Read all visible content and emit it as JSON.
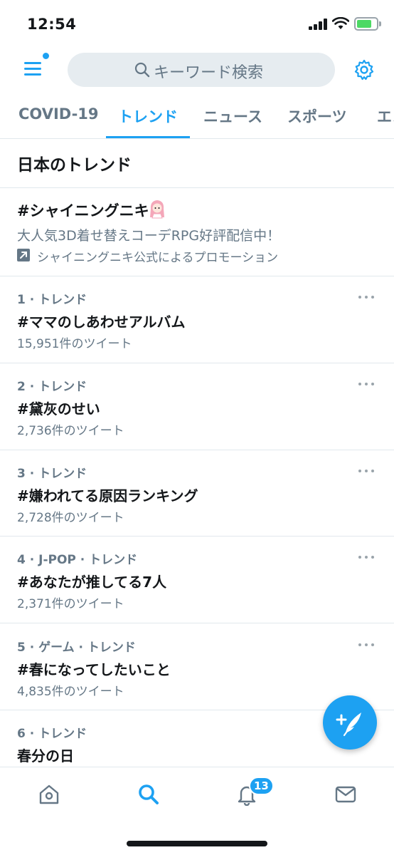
{
  "status_bar": {
    "time": "12:54"
  },
  "header": {
    "search_placeholder": "キーワード検索",
    "icons": [
      "menu-icon",
      "search-icon",
      "gear-icon"
    ]
  },
  "tabs": [
    {
      "label": "COVID-19",
      "active": false
    },
    {
      "label": "トレンド",
      "active": true
    },
    {
      "label": "ニュース",
      "active": false
    },
    {
      "label": "スポーツ",
      "active": false
    },
    {
      "label": "エンタメ",
      "active": false
    }
  ],
  "section_title": "日本のトレンド",
  "promoted": {
    "title": "#シャイニングニキ",
    "description": "大人気3D着せ替えコーデRPG好評配信中！",
    "promoted_by": "シャイニングニキ公式によるプロモーション"
  },
  "trends": [
    {
      "meta": "1 · トレンド",
      "name": "#ママのしあわせアルバム",
      "count": "15,951件のツイート"
    },
    {
      "meta": "2 · トレンド",
      "name": "#黛灰のせい",
      "count": "2,736件のツイート"
    },
    {
      "meta": "3 · トレンド",
      "name": "#嫌われてる原因ランキング",
      "count": "2,728件のツイート"
    },
    {
      "meta": "4 · J-POP · トレンド",
      "name": "#あなたが推してる7人",
      "count": "2,371件のツイート"
    },
    {
      "meta": "5 · ゲーム · トレンド",
      "name": "#春になってしたいこと",
      "count": "4,835件のツイート"
    },
    {
      "meta": "6 · トレンド",
      "name": "春分の日",
      "count": ""
    }
  ],
  "bottom_nav": {
    "items": [
      "home-icon",
      "search-icon",
      "notifications-icon",
      "messages-icon"
    ],
    "notification_badge": "13"
  },
  "colors": {
    "accent": "#1da1f2",
    "text": "#14171a",
    "secondary": "#657786",
    "divider": "#e1e8ed"
  }
}
